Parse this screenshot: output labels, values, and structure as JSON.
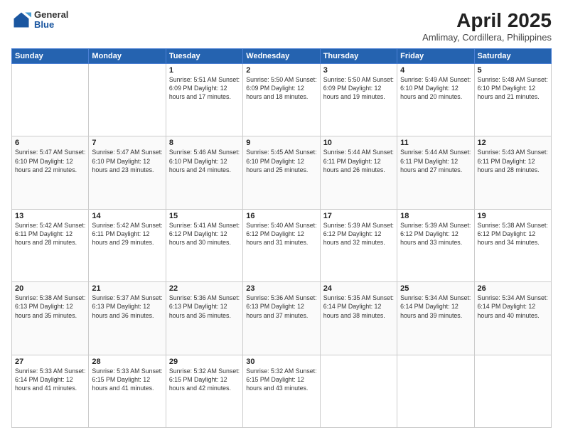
{
  "header": {
    "logo_general": "General",
    "logo_blue": "Blue",
    "month_title": "April 2025",
    "location": "Amlimay, Cordillera, Philippines"
  },
  "weekdays": [
    "Sunday",
    "Monday",
    "Tuesday",
    "Wednesday",
    "Thursday",
    "Friday",
    "Saturday"
  ],
  "weeks": [
    [
      {
        "day": "",
        "info": ""
      },
      {
        "day": "",
        "info": ""
      },
      {
        "day": "1",
        "info": "Sunrise: 5:51 AM\nSunset: 6:09 PM\nDaylight: 12 hours and 17 minutes."
      },
      {
        "day": "2",
        "info": "Sunrise: 5:50 AM\nSunset: 6:09 PM\nDaylight: 12 hours and 18 minutes."
      },
      {
        "day": "3",
        "info": "Sunrise: 5:50 AM\nSunset: 6:09 PM\nDaylight: 12 hours and 19 minutes."
      },
      {
        "day": "4",
        "info": "Sunrise: 5:49 AM\nSunset: 6:10 PM\nDaylight: 12 hours and 20 minutes."
      },
      {
        "day": "5",
        "info": "Sunrise: 5:48 AM\nSunset: 6:10 PM\nDaylight: 12 hours and 21 minutes."
      }
    ],
    [
      {
        "day": "6",
        "info": "Sunrise: 5:47 AM\nSunset: 6:10 PM\nDaylight: 12 hours and 22 minutes."
      },
      {
        "day": "7",
        "info": "Sunrise: 5:47 AM\nSunset: 6:10 PM\nDaylight: 12 hours and 23 minutes."
      },
      {
        "day": "8",
        "info": "Sunrise: 5:46 AM\nSunset: 6:10 PM\nDaylight: 12 hours and 24 minutes."
      },
      {
        "day": "9",
        "info": "Sunrise: 5:45 AM\nSunset: 6:10 PM\nDaylight: 12 hours and 25 minutes."
      },
      {
        "day": "10",
        "info": "Sunrise: 5:44 AM\nSunset: 6:11 PM\nDaylight: 12 hours and 26 minutes."
      },
      {
        "day": "11",
        "info": "Sunrise: 5:44 AM\nSunset: 6:11 PM\nDaylight: 12 hours and 27 minutes."
      },
      {
        "day": "12",
        "info": "Sunrise: 5:43 AM\nSunset: 6:11 PM\nDaylight: 12 hours and 28 minutes."
      }
    ],
    [
      {
        "day": "13",
        "info": "Sunrise: 5:42 AM\nSunset: 6:11 PM\nDaylight: 12 hours and 28 minutes."
      },
      {
        "day": "14",
        "info": "Sunrise: 5:42 AM\nSunset: 6:11 PM\nDaylight: 12 hours and 29 minutes."
      },
      {
        "day": "15",
        "info": "Sunrise: 5:41 AM\nSunset: 6:12 PM\nDaylight: 12 hours and 30 minutes."
      },
      {
        "day": "16",
        "info": "Sunrise: 5:40 AM\nSunset: 6:12 PM\nDaylight: 12 hours and 31 minutes."
      },
      {
        "day": "17",
        "info": "Sunrise: 5:39 AM\nSunset: 6:12 PM\nDaylight: 12 hours and 32 minutes."
      },
      {
        "day": "18",
        "info": "Sunrise: 5:39 AM\nSunset: 6:12 PM\nDaylight: 12 hours and 33 minutes."
      },
      {
        "day": "19",
        "info": "Sunrise: 5:38 AM\nSunset: 6:12 PM\nDaylight: 12 hours and 34 minutes."
      }
    ],
    [
      {
        "day": "20",
        "info": "Sunrise: 5:38 AM\nSunset: 6:13 PM\nDaylight: 12 hours and 35 minutes."
      },
      {
        "day": "21",
        "info": "Sunrise: 5:37 AM\nSunset: 6:13 PM\nDaylight: 12 hours and 36 minutes."
      },
      {
        "day": "22",
        "info": "Sunrise: 5:36 AM\nSunset: 6:13 PM\nDaylight: 12 hours and 36 minutes."
      },
      {
        "day": "23",
        "info": "Sunrise: 5:36 AM\nSunset: 6:13 PM\nDaylight: 12 hours and 37 minutes."
      },
      {
        "day": "24",
        "info": "Sunrise: 5:35 AM\nSunset: 6:14 PM\nDaylight: 12 hours and 38 minutes."
      },
      {
        "day": "25",
        "info": "Sunrise: 5:34 AM\nSunset: 6:14 PM\nDaylight: 12 hours and 39 minutes."
      },
      {
        "day": "26",
        "info": "Sunrise: 5:34 AM\nSunset: 6:14 PM\nDaylight: 12 hours and 40 minutes."
      }
    ],
    [
      {
        "day": "27",
        "info": "Sunrise: 5:33 AM\nSunset: 6:14 PM\nDaylight: 12 hours and 41 minutes."
      },
      {
        "day": "28",
        "info": "Sunrise: 5:33 AM\nSunset: 6:15 PM\nDaylight: 12 hours and 41 minutes."
      },
      {
        "day": "29",
        "info": "Sunrise: 5:32 AM\nSunset: 6:15 PM\nDaylight: 12 hours and 42 minutes."
      },
      {
        "day": "30",
        "info": "Sunrise: 5:32 AM\nSunset: 6:15 PM\nDaylight: 12 hours and 43 minutes."
      },
      {
        "day": "",
        "info": ""
      },
      {
        "day": "",
        "info": ""
      },
      {
        "day": "",
        "info": ""
      }
    ]
  ]
}
